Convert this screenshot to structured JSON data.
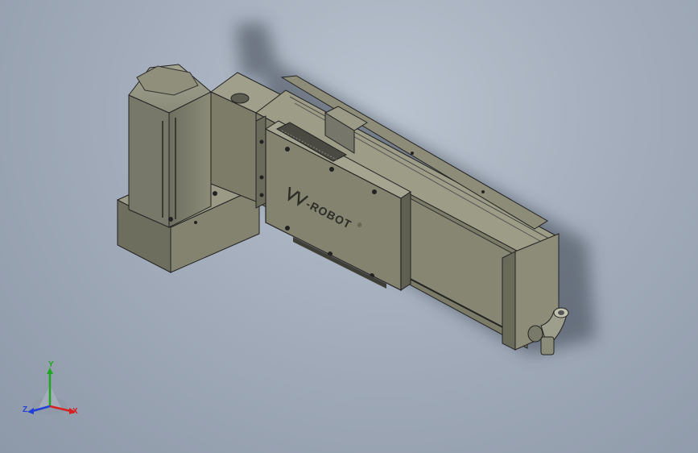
{
  "viewport": {
    "background_top": "#b9c3d0",
    "background_bottom": "#8d98a8"
  },
  "model": {
    "brand_text": "-ROBOT",
    "registered_mark": "®",
    "body_color": "#7a7a6a",
    "body_dark": "#55554a",
    "body_light": "#9a9a88"
  },
  "triad": {
    "x_label": "X",
    "y_label": "Y",
    "z_label": "Z",
    "x_color": "#d61f1f",
    "y_color": "#1fa51f",
    "z_color": "#1f3fd6"
  }
}
